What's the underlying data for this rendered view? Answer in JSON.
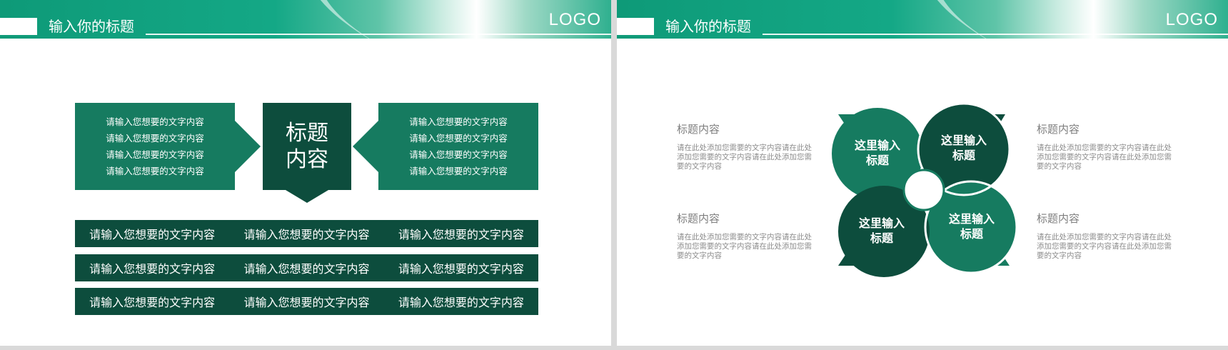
{
  "header": {
    "title": "输入你的标题",
    "logo": "LOGO"
  },
  "slide1": {
    "left_lines": [
      "请输入您想要的文字内容",
      "请输入您想要的文字内容",
      "请输入您想要的文字内容",
      "请输入您想要的文字内容"
    ],
    "right_lines": [
      "请输入您想要的文字内容",
      "请输入您想要的文字内容",
      "请输入您想要的文字内容",
      "请输入您想要的文字内容"
    ],
    "center_title_line1": "标题",
    "center_title_line2": "内容",
    "bars": [
      [
        "请输入您想要的文字内容",
        "请输入您想要的文字内容",
        "请输入您想要的文字内容"
      ],
      [
        "请输入您想要的文字内容",
        "请输入您想要的文字内容",
        "请输入您想要的文字内容"
      ],
      [
        "请输入您想要的文字内容",
        "请输入您想要的文字内容",
        "请输入您想要的文字内容"
      ]
    ]
  },
  "slide2": {
    "texts": [
      {
        "title": "标题内容",
        "body": "请在此处添加您需要的文字内容请在此处添加您需要的文字内容请在此处添加您需要的文字内容"
      },
      {
        "title": "标题内容",
        "body": "请在此处添加您需要的文字内容请在此处添加您需要的文字内容请在此处添加您需要的文字内容"
      },
      {
        "title": "标题内容",
        "body": "请在此处添加您需要的文字内容请在此处添加您需要的文字内容请在此处添加您需要的文字内容"
      },
      {
        "title": "标题内容",
        "body": "请在此处添加您需要的文字内容请在此处添加您需要的文字内容请在此处添加您需要的文字内容"
      }
    ],
    "petals": [
      {
        "line1": "这里输入",
        "line2": "标题"
      },
      {
        "line1": "这里输入",
        "line2": "标题"
      },
      {
        "line1": "这里输入",
        "line2": "标题"
      },
      {
        "line1": "这里输入",
        "line2": "标题"
      }
    ]
  },
  "colors": {
    "accent": "#14a886",
    "mid_green": "#167b60",
    "dark_green": "#0d4d3d"
  }
}
